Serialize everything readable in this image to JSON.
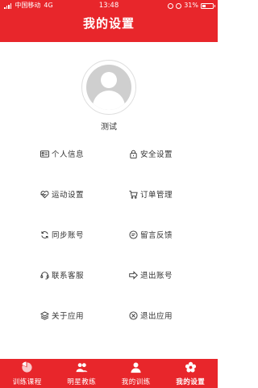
{
  "status_bar": {
    "carrier": "中国移动",
    "network": "4G",
    "time": "13:48",
    "battery": "31%"
  },
  "header": {
    "title": "我的设置"
  },
  "profile": {
    "username": "测试"
  },
  "menu": [
    {
      "label": "个人信息",
      "icon": "id-card-icon"
    },
    {
      "label": "安全设置",
      "icon": "lock-icon"
    },
    {
      "label": "运动设置",
      "icon": "heart-pulse-icon"
    },
    {
      "label": "订单管理",
      "icon": "cart-icon"
    },
    {
      "label": "同步账号",
      "icon": "sync-icon"
    },
    {
      "label": "留言反馈",
      "icon": "message-icon"
    },
    {
      "label": "联系客服",
      "icon": "headset-icon"
    },
    {
      "label": "退出账号",
      "icon": "arrow-right-icon"
    },
    {
      "label": "关于应用",
      "icon": "layers-icon"
    },
    {
      "label": "退出应用",
      "icon": "close-circle-icon"
    }
  ],
  "tabs": [
    {
      "label": "训练课程",
      "icon": "pie-icon"
    },
    {
      "label": "明星教练",
      "icon": "users-icon"
    },
    {
      "label": "我的训练",
      "icon": "user-icon"
    },
    {
      "label": "我的设置",
      "icon": "flower-settings-icon",
      "active": true
    }
  ],
  "colors": {
    "brand_red": "#e8262b",
    "text": "#333333",
    "avatar_grey": "#cfcfcf"
  }
}
